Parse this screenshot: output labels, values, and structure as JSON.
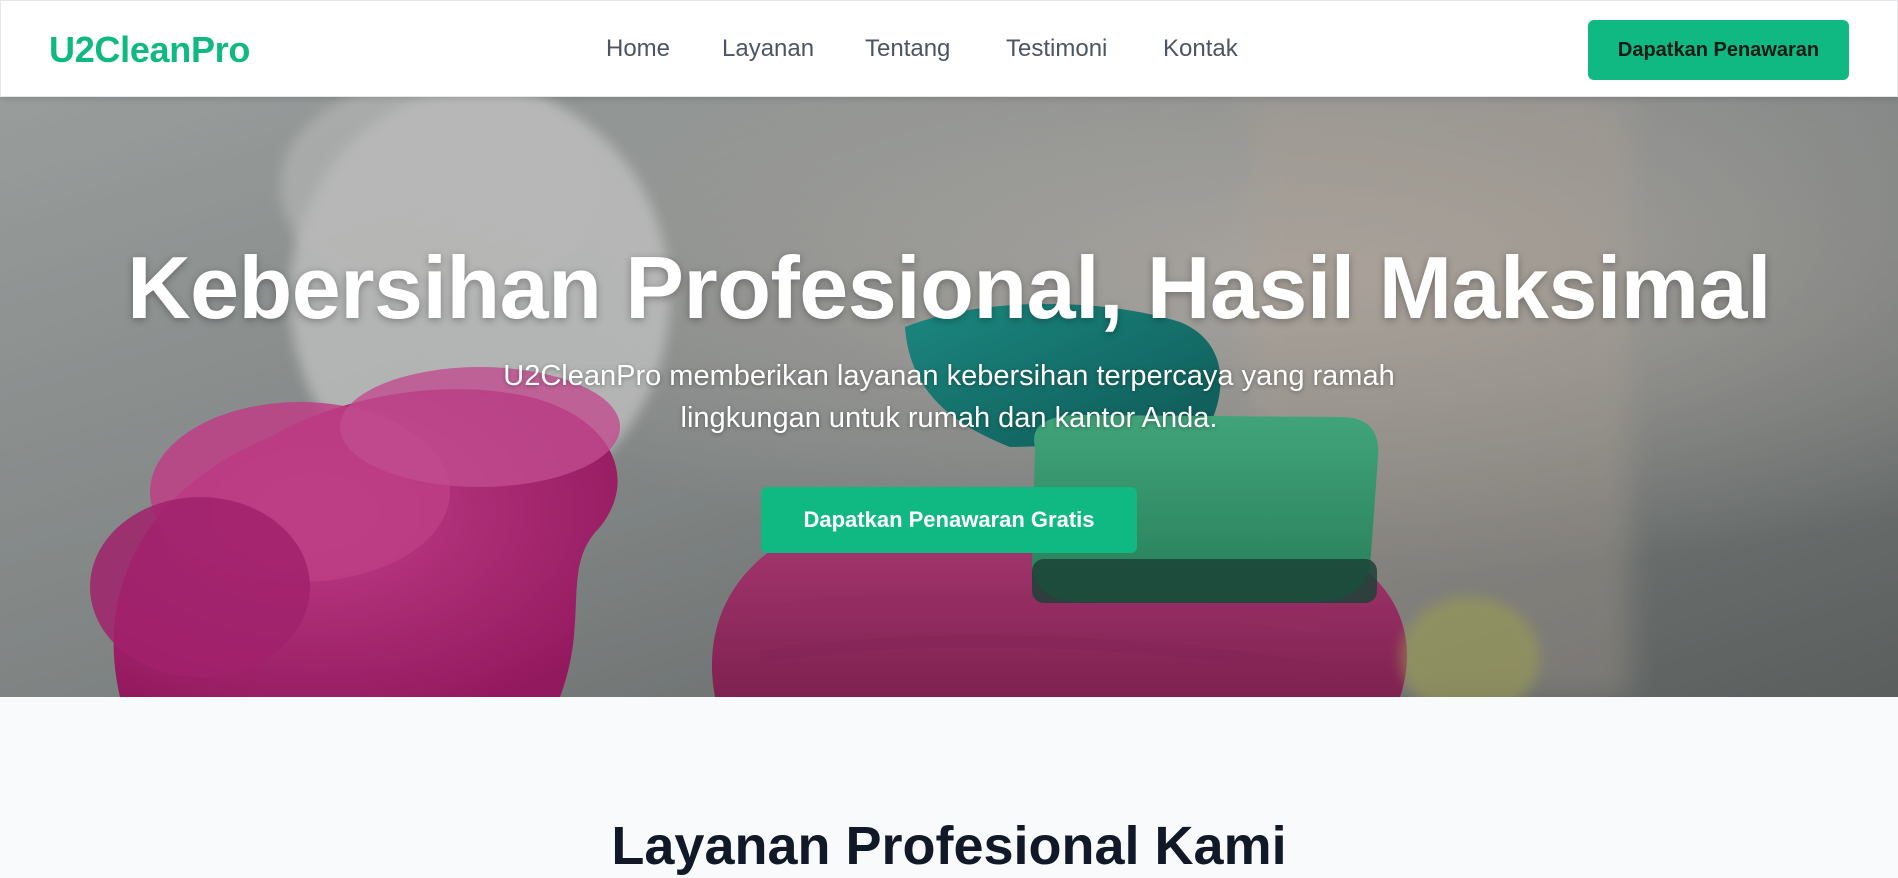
{
  "brand": {
    "name": "U2CleanPro",
    "color": "#10b981"
  },
  "nav": {
    "links": [
      "Home",
      "Layanan",
      "Tentang",
      "Testimoni",
      "Kontak"
    ],
    "cta_label": "Dapatkan Penawaran"
  },
  "hero": {
    "title": "Kebersihan Profesional, Hasil Maksimal",
    "subtitle": "U2CleanPro memberikan layanan kebersihan terpercaya yang ramah lingkungan untuk rumah dan kantor Anda.",
    "button_label": "Dapatkan Penawaran Gratis",
    "background_image": "cleaning-gloves-sponge-photo"
  },
  "services": {
    "title": "Layanan Profesional Kami"
  }
}
